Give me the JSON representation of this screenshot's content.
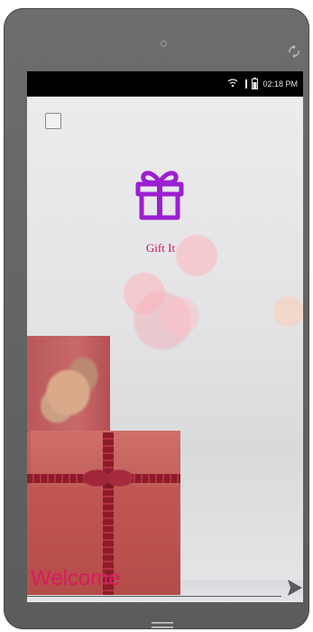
{
  "status_bar": {
    "time": "02:18 PM",
    "icons": [
      "wifi-icon",
      "signal-icon",
      "battery-icon"
    ]
  },
  "app": {
    "name": "Gift It",
    "logo_icon": "gift-icon",
    "brand_color": "#c2185b"
  },
  "welcome": {
    "text": "Welcome",
    "color": "#d81b60"
  },
  "controls": {
    "top_left_icon": "checkbox-icon",
    "next_icon": "arrow-right-icon",
    "device_rotate_icon": "rotate-icon",
    "home_icon": "home-lines-icon"
  }
}
